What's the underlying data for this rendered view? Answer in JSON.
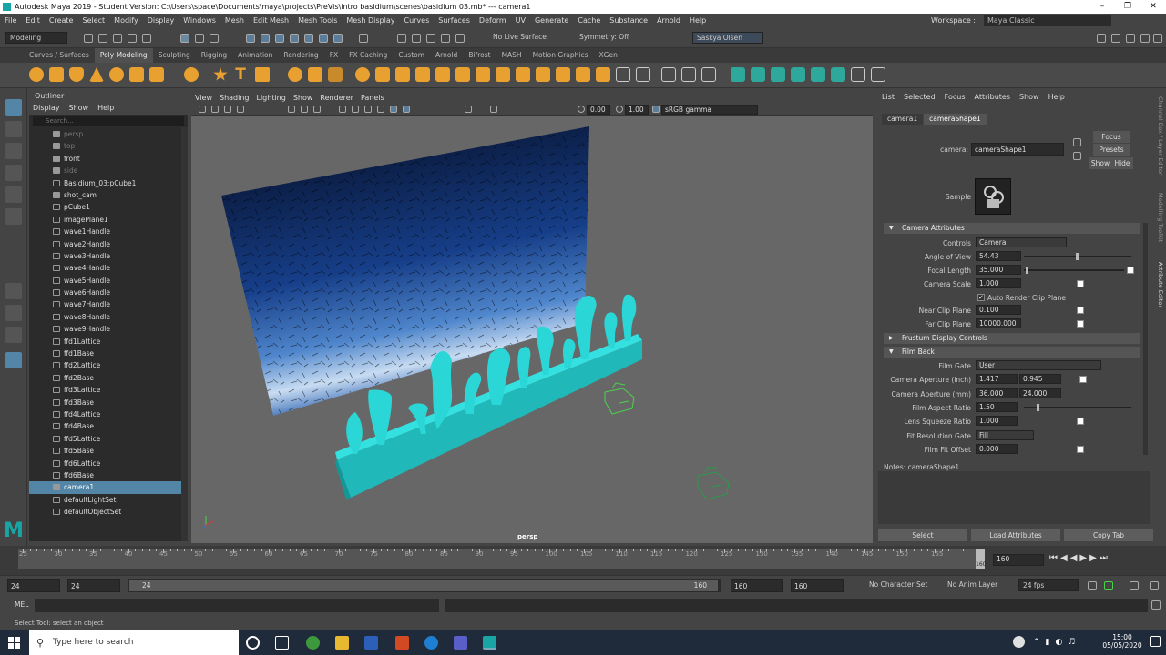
{
  "window": {
    "title": "Autodesk Maya 2019 - Student Version: C:\\Users\\space\\Documents\\maya\\projects\\PreVis\\intro basidium\\scenes\\basidium 03.mb*   ---   camera1"
  },
  "menu": [
    "File",
    "Edit",
    "Create",
    "Select",
    "Modify",
    "Display",
    "Windows",
    "Mesh",
    "Edit Mesh",
    "Mesh Tools",
    "Mesh Display",
    "Curves",
    "Surfaces",
    "Deform",
    "UV",
    "Generate",
    "Cache",
    "Substance",
    "Arnold",
    "Help"
  ],
  "workspace": {
    "label": "Workspace :",
    "value": "Maya Classic"
  },
  "statusline": {
    "mode": "Modeling",
    "live_surface": "No Live Surface",
    "symmetry": "Symmetry: Off",
    "user": "Saskya Olsen"
  },
  "shelf_tabs": [
    "Curves / Surfaces",
    "Poly Modeling",
    "Sculpting",
    "Rigging",
    "Animation",
    "Rendering",
    "FX",
    "FX Caching",
    "Custom",
    "Arnold",
    "Bifrost",
    "MASH",
    "Motion Graphics",
    "XGen"
  ],
  "shelf_active": "Poly Modeling",
  "outliner": {
    "title": "Outliner",
    "menu": [
      "Display",
      "Show",
      "Help"
    ],
    "search_placeholder": "Search...",
    "items": [
      {
        "label": "persp",
        "type": "camera",
        "dim": true
      },
      {
        "label": "top",
        "type": "camera",
        "dim": true
      },
      {
        "label": "front",
        "type": "camera",
        "dim": false
      },
      {
        "label": "side",
        "type": "camera",
        "dim": true
      },
      {
        "label": "Basidium_03:pCube1",
        "type": "mesh",
        "dim": false
      },
      {
        "label": "shot_cam",
        "type": "camera",
        "dim": false
      },
      {
        "label": "pCube1",
        "type": "mesh",
        "dim": false
      },
      {
        "label": "imagePlane1",
        "type": "plane",
        "dim": false
      },
      {
        "label": "wave1Handle",
        "type": "handle",
        "dim": false
      },
      {
        "label": "wave2Handle",
        "type": "handle",
        "dim": false
      },
      {
        "label": "wave3Handle",
        "type": "handle",
        "dim": false
      },
      {
        "label": "wave4Handle",
        "type": "handle",
        "dim": false
      },
      {
        "label": "wave5Handle",
        "type": "handle",
        "dim": false
      },
      {
        "label": "wave6Handle",
        "type": "handle",
        "dim": false
      },
      {
        "label": "wave7Handle",
        "type": "handle",
        "dim": false
      },
      {
        "label": "wave8Handle",
        "type": "handle",
        "dim": false
      },
      {
        "label": "wave9Handle",
        "type": "handle",
        "dim": false
      },
      {
        "label": "ffd1Lattice",
        "type": "lattice",
        "dim": false
      },
      {
        "label": "ffd1Base",
        "type": "lattice",
        "dim": false
      },
      {
        "label": "ffd2Lattice",
        "type": "lattice",
        "dim": false
      },
      {
        "label": "ffd2Base",
        "type": "lattice",
        "dim": false
      },
      {
        "label": "ffd3Lattice",
        "type": "lattice",
        "dim": false
      },
      {
        "label": "ffd3Base",
        "type": "lattice",
        "dim": false
      },
      {
        "label": "ffd4Lattice",
        "type": "lattice",
        "dim": false
      },
      {
        "label": "ffd4Base",
        "type": "lattice",
        "dim": false
      },
      {
        "label": "ffd5Lattice",
        "type": "lattice",
        "dim": false
      },
      {
        "label": "ffd5Base",
        "type": "lattice",
        "dim": false
      },
      {
        "label": "ffd6Lattice",
        "type": "lattice",
        "dim": false
      },
      {
        "label": "ffd6Base",
        "type": "lattice",
        "dim": false
      },
      {
        "label": "camera1",
        "type": "camera",
        "dim": false,
        "selected": true
      },
      {
        "label": "defaultLightSet",
        "type": "set",
        "dim": false
      },
      {
        "label": "defaultObjectSet",
        "type": "set",
        "dim": false
      }
    ]
  },
  "viewport": {
    "menu": [
      "View",
      "Shading",
      "Lighting",
      "Show",
      "Renderer",
      "Panels"
    ],
    "exposure": "0.00",
    "gamma": "1.00",
    "color_space": "sRGB gamma",
    "camera_label": "persp"
  },
  "attribute_editor": {
    "menu": [
      "List",
      "Selected",
      "Focus",
      "Attributes",
      "Show",
      "Help"
    ],
    "tabs": [
      "camera1",
      "cameraShape1"
    ],
    "active_tab": "cameraShape1",
    "node_label": "camera:",
    "node_value": "cameraShape1",
    "focus_btn": "Focus",
    "presets_btn": "Presets",
    "show_btn": "Show",
    "hide_btn": "Hide",
    "sample_label": "Sample",
    "sections": {
      "camera_attributes": "Camera Attributes",
      "frustum": "Frustum Display Controls",
      "film_back": "Film Back"
    },
    "controls_label": "Controls",
    "controls_value": "Camera",
    "angle_label": "Angle of View",
    "angle_value": "54.43",
    "angle_level": 0.48,
    "focal_label": "Focal Length",
    "focal_value": "35.000",
    "focal_level": 0.02,
    "scale_label": "Camera Scale",
    "scale_value": "1.000",
    "auto_clip_label": "Auto Render Clip Plane",
    "near_label": "Near Clip Plane",
    "near_value": "0.100",
    "far_label": "Far Clip Plane",
    "far_value": "10000.000",
    "film_gate_label": "Film Gate",
    "film_gate_value": "User",
    "ap_inch_label": "Camera Aperture (inch)",
    "ap_inch_a": "1.417",
    "ap_inch_b": "0.945",
    "ap_mm_label": "Camera Aperture (mm)",
    "ap_mm_a": "36.000",
    "ap_mm_b": "24.000",
    "aspect_label": "Film Aspect Ratio",
    "aspect_value": "1.50",
    "aspect_level": 0.12,
    "squeeze_label": "Lens Squeeze Ratio",
    "squeeze_value": "1.000",
    "fit_gate_label": "Fit Resolution Gate",
    "fit_gate_value": "Fill",
    "fit_offset_label": "Film Fit Offset",
    "fit_offset_value": "0.000",
    "notes_label": "Notes:  cameraShape1",
    "bottom_buttons": [
      "Select",
      "Load Attributes",
      "Copy Tab"
    ]
  },
  "side_tabs": [
    "Channel Box / Layer Editor",
    "Modelling Toolkit",
    "Attribute Editor"
  ],
  "timeline": {
    "ticks": [
      "25",
      "30",
      "35",
      "40",
      "45",
      "50",
      "55",
      "60",
      "65",
      "70",
      "75",
      "80",
      "85",
      "90",
      "95",
      "100",
      "105",
      "110",
      "115",
      "120",
      "125",
      "130",
      "135",
      "140",
      "145",
      "150",
      "155"
    ],
    "current": "160",
    "current_field": "160"
  },
  "range": {
    "start": "24",
    "start2": "24",
    "slider_start": "24",
    "slider_end": "160",
    "end": "160",
    "end2": "160",
    "character_set": "No Character Set",
    "anim_layer": "No Anim Layer",
    "fps": "24 fps"
  },
  "command": {
    "label": "MEL"
  },
  "help_line": "Select Tool: select an object",
  "taskbar": {
    "search": "Type here to search",
    "time": "15:00",
    "date": "05/05/2020"
  }
}
